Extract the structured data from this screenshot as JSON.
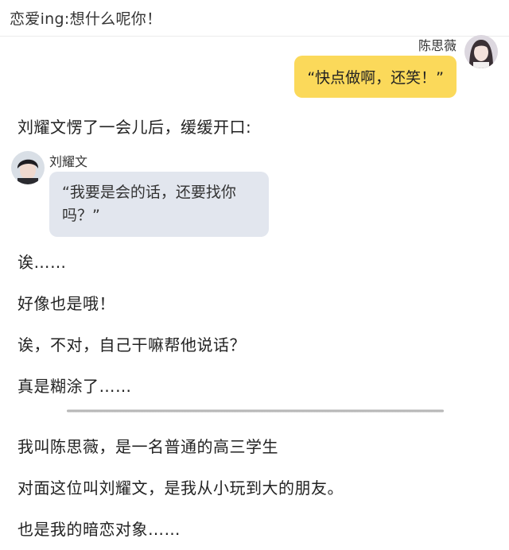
{
  "header": {
    "title": "恋爱ing:想什么呢你！"
  },
  "messages": [
    {
      "side": "right",
      "sender": "陈思薇",
      "text": "“快点做啊，还笑！”",
      "bubble_color": "#fbd95a"
    },
    {
      "side": "left",
      "sender": "刘耀文",
      "text": "“我要是会的话，还要找你吗？”",
      "bubble_color": "#e2e6ee"
    }
  ],
  "narration_1": "刘耀文愣了一会儿后，缓缓开口:",
  "narration_block": [
    "诶……",
    "好像也是哦！",
    "诶，不对，自己干嘛帮他说话？",
    "真是糊涂了……"
  ],
  "narration_after_divider": [
    "我叫陈思薇，是一名普通的高三学生",
    "对面这位叫刘耀文，是我从小玩到大的朋友。",
    "也是我的暗恋对象……"
  ]
}
